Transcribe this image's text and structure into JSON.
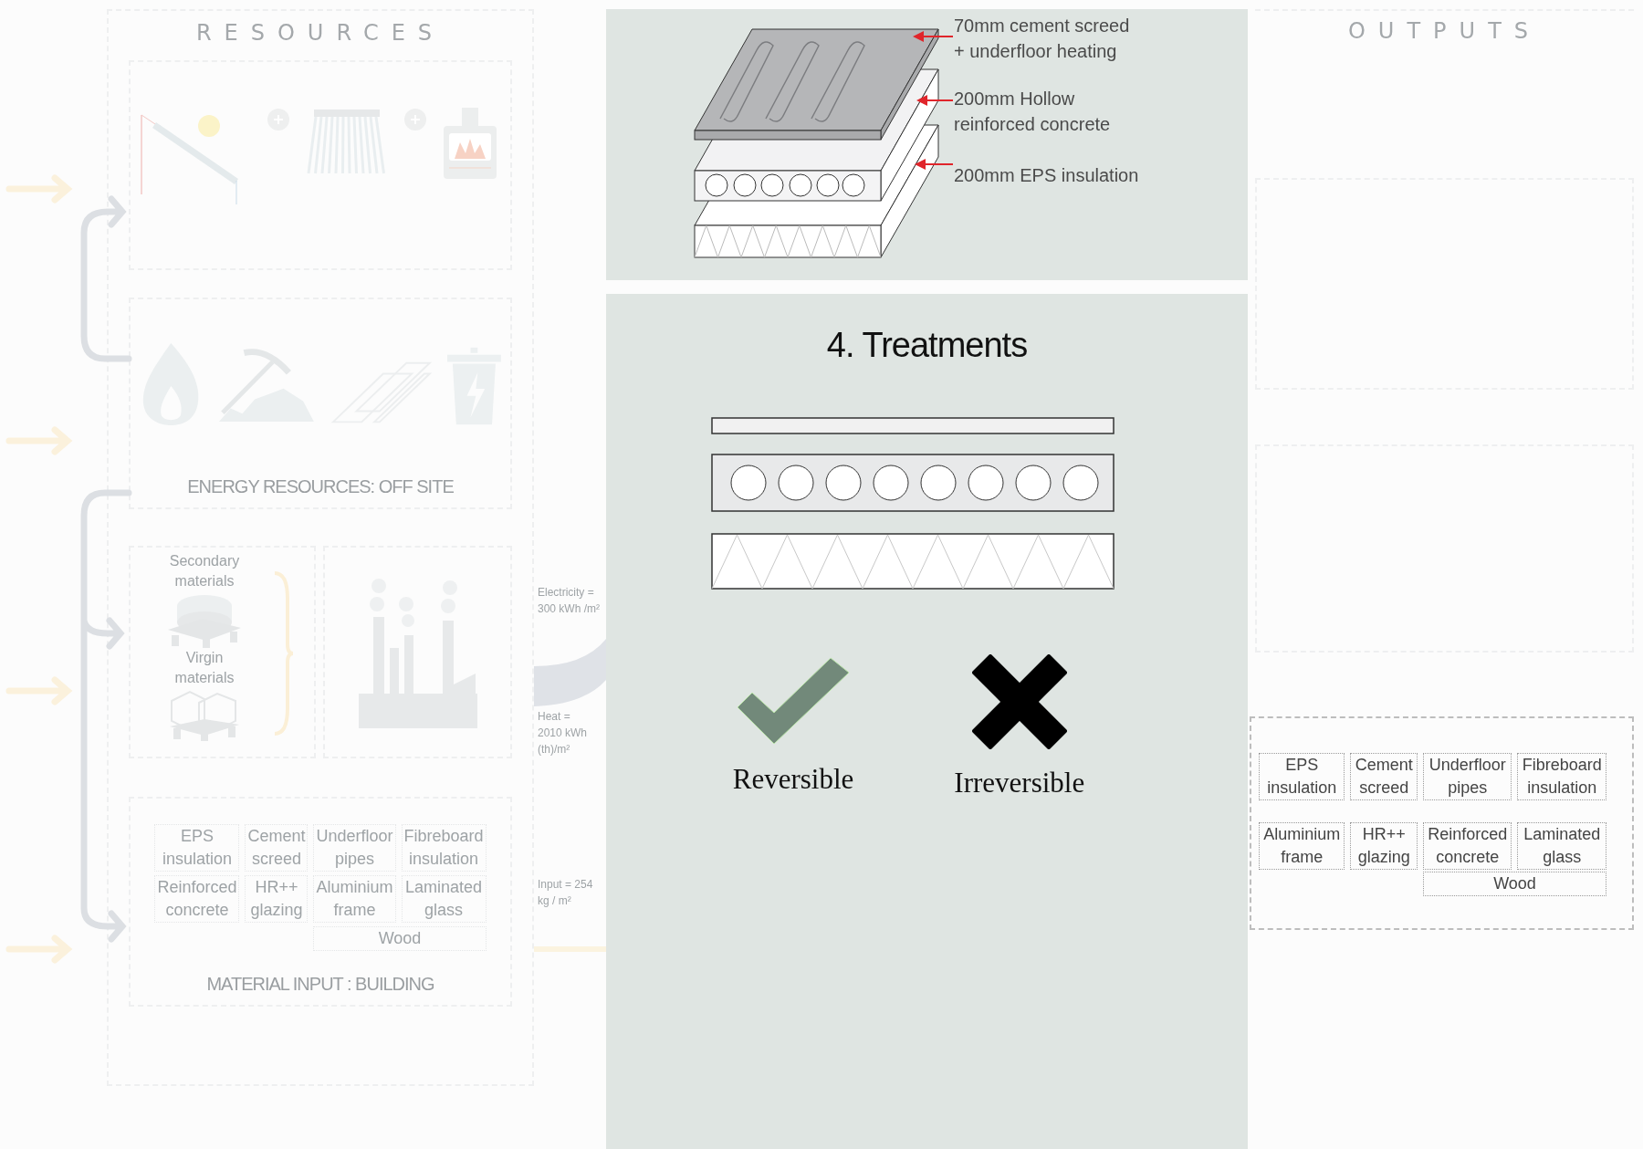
{
  "resources": {
    "title": "RESOURCES",
    "off_site_label": "ENERGY RESOURCES: OFF SITE",
    "material_sources": [
      "Secondary\nmaterials",
      "Virgin\nmaterials"
    ],
    "material_input": {
      "label": "MATERIAL INPUT : BUILDING",
      "items": [
        {
          "text": "EPS\ninsulation",
          "wide": false
        },
        {
          "text": "Cement\nscreed",
          "wide": false
        },
        {
          "text": "Underfloor\npipes",
          "wide": false
        },
        {
          "text": "Fibreboard\ninsulation",
          "wide": false
        },
        {
          "text": "Reinforced\nconcrete",
          "wide": false
        },
        {
          "text": "HR++\nglazing",
          "wide": false
        },
        {
          "text": "Aluminium\nframe",
          "wide": false
        },
        {
          "text": "Laminated\nglass",
          "wide": false
        },
        {
          "text": "Wood",
          "wide": true
        }
      ]
    }
  },
  "flows": [
    "Electricity  =\n300 kWh /m²",
    "Heat =\n2010 kWh\n(th)/m²",
    "Input = 254\nkg / m²"
  ],
  "floor_detail": {
    "layers": [
      "70mm cement screed\n+ underfloor heating",
      "200mm Hollow\nreinforced concrete",
      "200mm EPS insulation"
    ]
  },
  "treatments": {
    "title": "4. Treatments",
    "options": [
      {
        "kind": "check",
        "label": "Reversible"
      },
      {
        "kind": "cross",
        "label": "Irreversible"
      }
    ]
  },
  "outputs": {
    "title": "OUTPUTS",
    "items": [
      {
        "text": "EPS\ninsulation",
        "wide": false
      },
      {
        "text": "Cement\nscreed",
        "wide": false
      },
      {
        "text": "Underfloor\npipes",
        "wide": false
      },
      {
        "text": "Fibreboard\ninsulation",
        "wide": false
      },
      {
        "text": "Aluminium\nframe",
        "wide": false
      },
      {
        "text": "HR++\nglazing",
        "wide": false
      },
      {
        "text": "Reinforced\nconcrete",
        "wide": false
      },
      {
        "text": "Laminated\nglass",
        "wide": false
      },
      {
        "text": "Wood",
        "wide": true
      }
    ]
  }
}
